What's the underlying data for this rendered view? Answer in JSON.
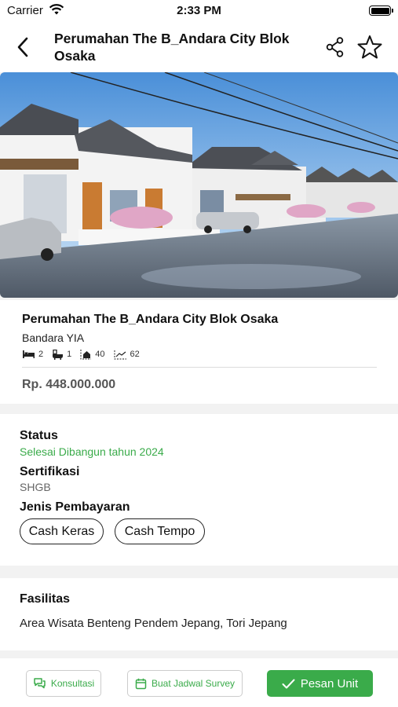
{
  "status_bar": {
    "carrier": "Carrier",
    "time": "2:33 PM"
  },
  "nav": {
    "title": "Perumahan The B_Andara City Blok Osaka"
  },
  "property": {
    "name": "Perumahan The B_Andara City Blok Osaka",
    "location": "Bandara YIA",
    "specs": {
      "bedrooms": "2",
      "bathrooms": "1",
      "building_area": "40",
      "land_area": "62"
    },
    "price": "Rp. 448.000.000"
  },
  "details": {
    "status_label": "Status",
    "status_value": "Selesai Dibangun tahun 2024",
    "certification_label": "Sertifikasi",
    "certification_value": "SHGB",
    "payment_label": "Jenis Pembayaran",
    "payment_options": [
      "Cash Keras",
      "Cash Tempo"
    ]
  },
  "facilities": {
    "label": "Fasilitas",
    "value": "Area Wisata Benteng Pendem Jepang, Tori Jepang"
  },
  "actions": {
    "consult": "Konsultasi",
    "schedule": "Buat Jadwal Survey",
    "order": "Pesan Unit"
  },
  "colors": {
    "accent": "#3aab4a",
    "text": "#111111",
    "muted": "#666666",
    "background": "#f2f2f2"
  }
}
